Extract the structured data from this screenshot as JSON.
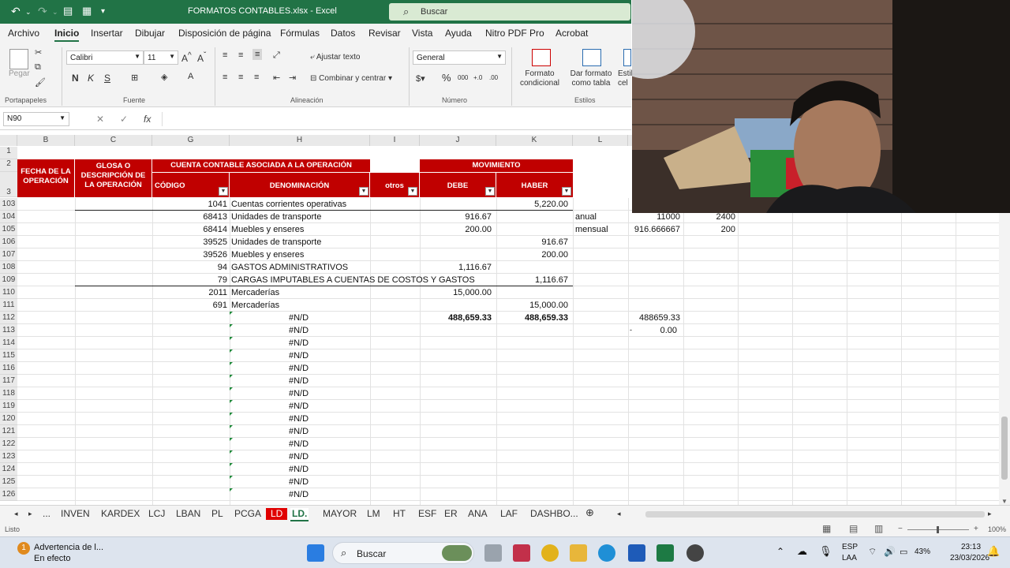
{
  "title_bar": {
    "file_title": "FORMATOS CONTABLES.xlsx  -  Excel",
    "search_placeholder": "Buscar"
  },
  "menu": [
    "Archivo",
    "Inicio",
    "Insertar",
    "Dibujar",
    "Disposición de página",
    "Fórmulas",
    "Datos",
    "Revisar",
    "Vista",
    "Ayuda",
    "Nitro PDF Pro",
    "Acrobat"
  ],
  "ribbon": {
    "paste_label": "Pegar",
    "font_name": "Calibri",
    "font_size": "11",
    "bold": "N",
    "italic": "K",
    "underline": "S",
    "wrap_text": "Ajustar texto",
    "merge_center": "Combinar y centrar",
    "number_format": "General",
    "cond_format": "Formato condicional",
    "table_format": "Dar formato como tabla",
    "styles_cut": "Estil cel",
    "groups": [
      "Portapapeles",
      "Fuente",
      "Alineación",
      "Número",
      "Estilos"
    ]
  },
  "formula_bar": {
    "name_box": "N90",
    "fx": "fx"
  },
  "columns": [
    "B",
    "C",
    "G",
    "H",
    "I",
    "J",
    "K",
    "L"
  ],
  "header": {
    "fecha": "FECHA DE LA OPERACIÓN",
    "glosa": "GLOSA O DESCRIPCIÓN DE LA OPERACIÓN",
    "cuenta": "CUENTA CONTABLE ASOCIADA A LA OPERACIÓN",
    "codigo": "CÓDIGO",
    "denominacion": "DENOMINACIÓN",
    "otros": "otros",
    "movimiento": "MOVIMIENTO",
    "debe": "DEBE",
    "haber": "HABER"
  },
  "header_rows": [
    "1",
    "2",
    "3"
  ],
  "rows": [
    {
      "n": "103",
      "code": "1041",
      "denom": "Cuentas corrientes operativas",
      "debe": "",
      "haber": "5,220.00",
      "l": "",
      "m": "",
      "n2": ""
    },
    {
      "n": "104",
      "code": "68413",
      "denom": "Unidades de transporte",
      "debe": "916.67",
      "haber": "",
      "l": "anual",
      "m": "11000",
      "n2": "2400"
    },
    {
      "n": "105",
      "code": "68414",
      "denom": "Muebles y enseres",
      "debe": "200.00",
      "haber": "",
      "l": "mensual",
      "m": "916.666667",
      "n2": "200"
    },
    {
      "n": "106",
      "code": "39525",
      "denom": "Unidades de transporte",
      "debe": "",
      "haber": "916.67",
      "l": "",
      "m": "",
      "n2": ""
    },
    {
      "n": "107",
      "code": "39526",
      "denom": "Muebles y enseres",
      "debe": "",
      "haber": "200.00",
      "l": "",
      "m": "",
      "n2": ""
    },
    {
      "n": "108",
      "code": "94",
      "denom": "GASTOS ADMINISTRATIVOS",
      "debe": "1,116.67",
      "haber": "",
      "l": "",
      "m": "",
      "n2": ""
    },
    {
      "n": "109",
      "code": "79",
      "denom": "CARGAS IMPUTABLES A CUENTAS DE COSTOS Y GASTOS",
      "debe": "",
      "haber": "1,116.67",
      "l": "",
      "m": "",
      "n2": ""
    },
    {
      "n": "110",
      "code": "2011",
      "denom": "Mercaderías",
      "debe": "15,000.00",
      "haber": "",
      "l": "",
      "m": "",
      "n2": ""
    },
    {
      "n": "111",
      "code": "691",
      "denom": "Mercaderías",
      "debe": "",
      "haber": "15,000.00",
      "l": "",
      "m": "",
      "n2": ""
    }
  ],
  "totals": {
    "n": "112",
    "denom": "#N/D",
    "debe": "488,659.33",
    "haber": "488,659.33",
    "m": "488659.33"
  },
  "row113": {
    "n": "113",
    "denom": "#N/D",
    "l": "-",
    "m": "0.00"
  },
  "na_rows": [
    "114",
    "115",
    "116",
    "117",
    "118",
    "119",
    "120",
    "121",
    "122",
    "123",
    "124",
    "125",
    "126"
  ],
  "na_text": "#N/D",
  "sheet_tabs": [
    "INVEN",
    "KARDEX",
    "LCJ",
    "LBAN",
    "PL",
    "PCGA",
    "LD",
    "LD.",
    "MAYOR",
    "LM",
    "HT",
    "ESF",
    "ER",
    "ANA",
    "LAF",
    "DASHBO..."
  ],
  "status": {
    "ready": "Listo",
    "zoom": "100%"
  },
  "taskbar": {
    "notif_title": "Advertencia de l...",
    "notif_sub": "En efecto",
    "search": "Buscar",
    "lang1": "ESP",
    "lang2": "LAA",
    "battery": "43%",
    "time": "23:13",
    "date": "23/03/2026"
  }
}
